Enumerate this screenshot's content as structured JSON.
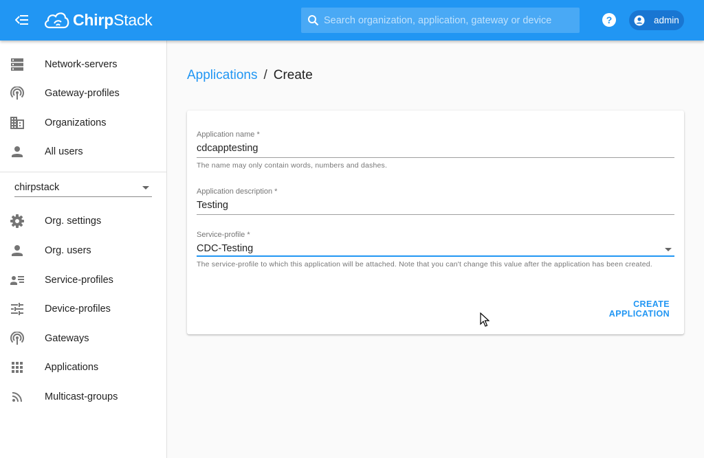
{
  "header": {
    "logo_text_bold": "Chirp",
    "logo_text_light": "Stack",
    "search_placeholder": "Search organization, application, gateway or device",
    "help_symbol": "?",
    "user_name": "admin",
    "brand_color": "#2196f3"
  },
  "sidebar": {
    "admin_items": [
      {
        "label": "Network-servers",
        "icon": "server-icon"
      },
      {
        "label": "Gateway-profiles",
        "icon": "broadcast-tower-icon"
      },
      {
        "label": "Organizations",
        "icon": "building-icon"
      },
      {
        "label": "All users",
        "icon": "person-icon"
      }
    ],
    "organization_selected": "chirpstack",
    "org_items": [
      {
        "label": "Org. settings",
        "icon": "gear-icon"
      },
      {
        "label": "Org. users",
        "icon": "person-icon"
      },
      {
        "label": "Service-profiles",
        "icon": "account-details-icon"
      },
      {
        "label": "Device-profiles",
        "icon": "tune-icon"
      },
      {
        "label": "Gateways",
        "icon": "broadcast-tower-icon"
      },
      {
        "label": "Applications",
        "icon": "apps-grid-icon"
      },
      {
        "label": "Multicast-groups",
        "icon": "rss-icon"
      }
    ]
  },
  "breadcrumb": {
    "parent": "Applications",
    "separator": "/",
    "current": "Create"
  },
  "form": {
    "name_label": "Application name *",
    "name_value": "cdcapptesting",
    "name_help": "The name may only contain words, numbers and dashes.",
    "description_label": "Application description *",
    "description_value": "Testing",
    "service_profile_label": "Service-profile *",
    "service_profile_value": "CDC-Testing",
    "service_profile_help": "The service-profile to which this application will be attached. Note that you can't change this value after the application has been created.",
    "submit_label": "CREATE APPLICATION"
  }
}
